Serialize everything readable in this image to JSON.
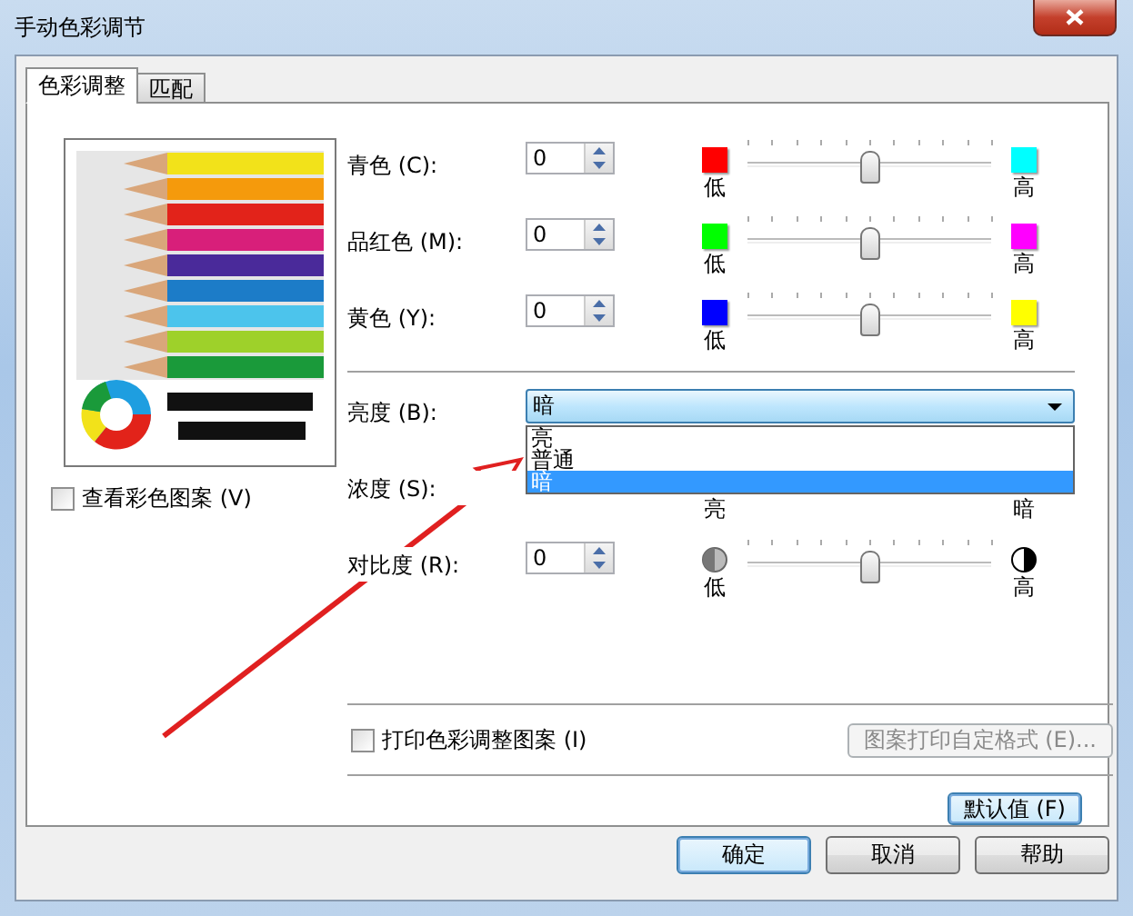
{
  "window": {
    "title": "手动色彩调节"
  },
  "tabs": [
    {
      "label": "色彩调整",
      "selected": true
    },
    {
      "label": "匹配",
      "selected": false
    }
  ],
  "preview": {
    "kind": "picture",
    "show_pattern": {
      "label": "查看彩色图案 (V)",
      "checked": false
    }
  },
  "adjustments": [
    {
      "kind": "slider",
      "label": "青色 (C):",
      "value": "0",
      "level": 0.5,
      "low": {
        "kind": "swatch",
        "color": "#ff0000",
        "label": "低"
      },
      "high": {
        "kind": "swatch",
        "color": "#00ffff",
        "label": "高"
      }
    },
    {
      "kind": "slider",
      "label": "品红色 (M):",
      "value": "0",
      "level": 0.5,
      "low": {
        "kind": "swatch",
        "color": "#00ff00",
        "label": "低"
      },
      "high": {
        "kind": "swatch",
        "color": "#ff00ff",
        "label": "高"
      }
    },
    {
      "kind": "slider",
      "label": "黄色 (Y):",
      "value": "0",
      "level": 0.5,
      "low": {
        "kind": "swatch",
        "color": "#0000ff",
        "label": "低"
      },
      "high": {
        "kind": "swatch",
        "color": "#ffff00",
        "label": "高"
      }
    },
    {
      "kind": "divider"
    },
    {
      "kind": "dropdown",
      "label": "亮度 (B):",
      "value": "暗",
      "expanded": true,
      "options": [
        {
          "label": "亮",
          "selected": false
        },
        {
          "label": "普通",
          "selected": false
        },
        {
          "label": "暗",
          "selected": true
        }
      ]
    },
    {
      "kind": "covered",
      "label": "浓度 (S):",
      "low": {
        "label": "亮"
      },
      "high": {
        "label": "暗"
      }
    },
    {
      "kind": "slider",
      "label": "对比度 (R):",
      "value": "0",
      "level": 0.5,
      "low": {
        "kind": "half-circle",
        "label": "低"
      },
      "high": {
        "kind": "contrast-circle",
        "label": "高"
      }
    }
  ],
  "print_pattern": {
    "label": "打印色彩调整图案 (I)",
    "checked": false
  },
  "print_format_button": {
    "label": "图案打印自定格式 (E)...",
    "disabled": true
  },
  "default_button": {
    "label": "默认值 (F)"
  },
  "buttons": [
    {
      "label": "确定",
      "default": true
    },
    {
      "label": "取消",
      "default": false
    },
    {
      "label": "帮助",
      "default": false
    }
  ]
}
